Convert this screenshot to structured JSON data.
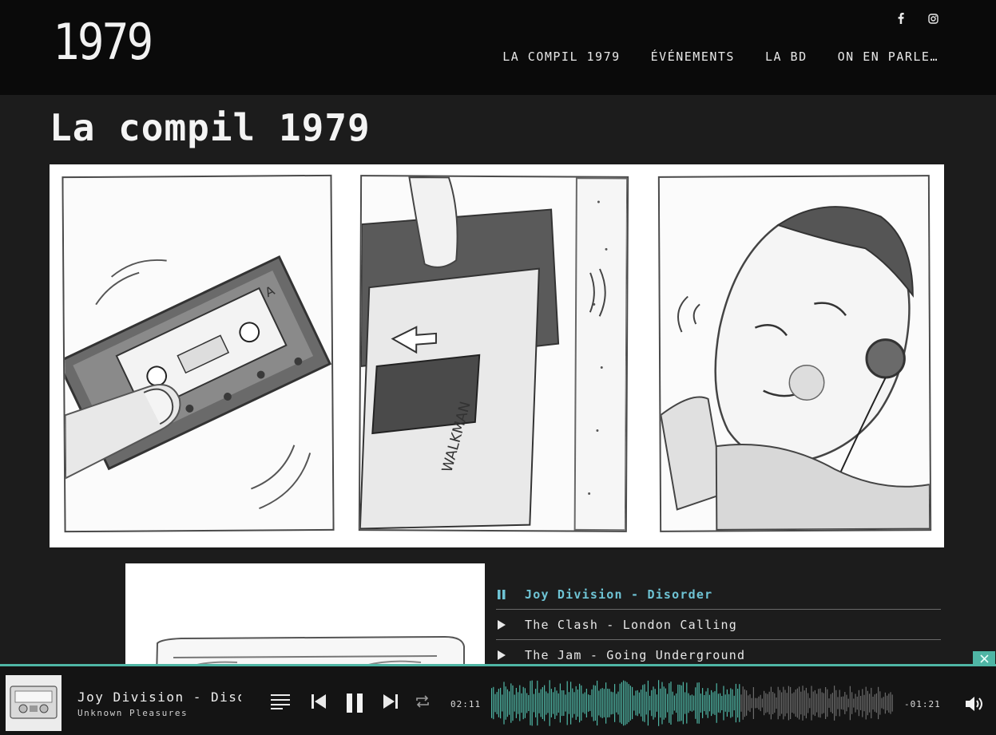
{
  "header": {
    "logo": "1979",
    "social": [
      {
        "icon": "facebook-icon"
      },
      {
        "icon": "instagram-icon"
      }
    ],
    "nav": [
      {
        "label": "LA COMPIL 1979"
      },
      {
        "label": "ÉVÉNEMENTS"
      },
      {
        "label": "LA BD"
      },
      {
        "label": "ON EN PARLE…"
      }
    ]
  },
  "page": {
    "title": "La compil 1979"
  },
  "comic": {
    "panels": [
      {
        "caption_text": "A"
      },
      {
        "caption_text": "WALKMAN"
      },
      {
        "caption_text": ""
      }
    ]
  },
  "playlist": {
    "tracks": [
      {
        "label": "Joy Division - Disorder",
        "state": "playing"
      },
      {
        "label": "The Clash - London Calling",
        "state": "paused"
      },
      {
        "label": "The Jam - Going Underground",
        "state": "paused"
      }
    ]
  },
  "player": {
    "now_playing_title": "Joy Division - Disorder",
    "now_playing_album": "Unknown Pleasures",
    "time_current": "02:11",
    "time_remaining": "-01:21",
    "progress": 0.62,
    "colors": {
      "accent": "#4fb6a5",
      "active_track": "#6ec3d4",
      "wave_unplayed": "#6b6b6b"
    }
  }
}
